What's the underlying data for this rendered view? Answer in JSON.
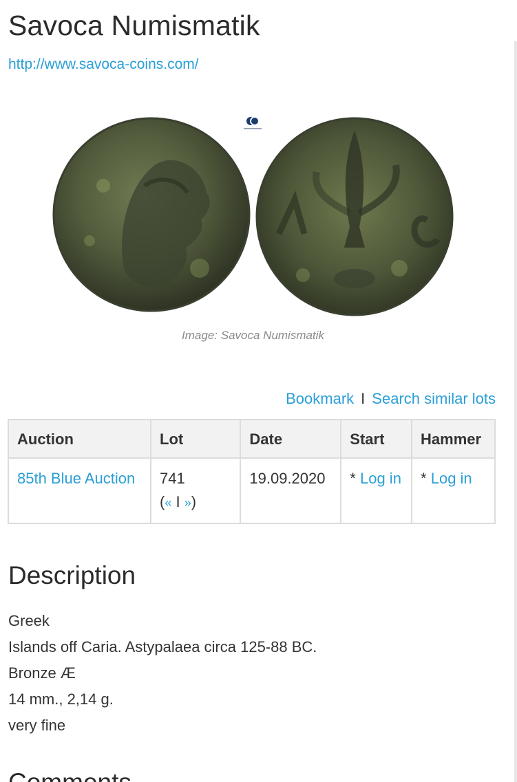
{
  "seller": {
    "name": "Savoca Numismatik",
    "url": "http://www.savoca-coins.com/"
  },
  "image": {
    "caption": "Image: Savoca Numismatik",
    "description": "obverse and reverse of a bronze coin"
  },
  "actions": {
    "bookmark": "Bookmark",
    "separator": "I",
    "search_similar": "Search similar lots"
  },
  "lot_table": {
    "headers": [
      "Auction",
      "Lot",
      "Date",
      "Start",
      "Hammer"
    ],
    "row": {
      "auction": "85th Blue Auction",
      "lot_number": "741",
      "prev_arrow": "«",
      "nav_sep": "I",
      "next_arrow": "»",
      "date": "19.09.2020",
      "start_prefix": "* ",
      "start_link": "Log in",
      "hammer_prefix": "* ",
      "hammer_link": "Log in"
    }
  },
  "description": {
    "title": "Description",
    "lines": [
      "Greek",
      "Islands off Caria. Astypalaea circa 125-88 BC.",
      "Bronze Æ",
      "14 mm., 2,14 g.",
      "very fine"
    ]
  },
  "next_section_title": "Comments",
  "colors": {
    "link": "#2a9fd6",
    "table_header_bg": "#f2f2f2",
    "border": "#dcdcdc",
    "caption": "#8a8a8a"
  }
}
